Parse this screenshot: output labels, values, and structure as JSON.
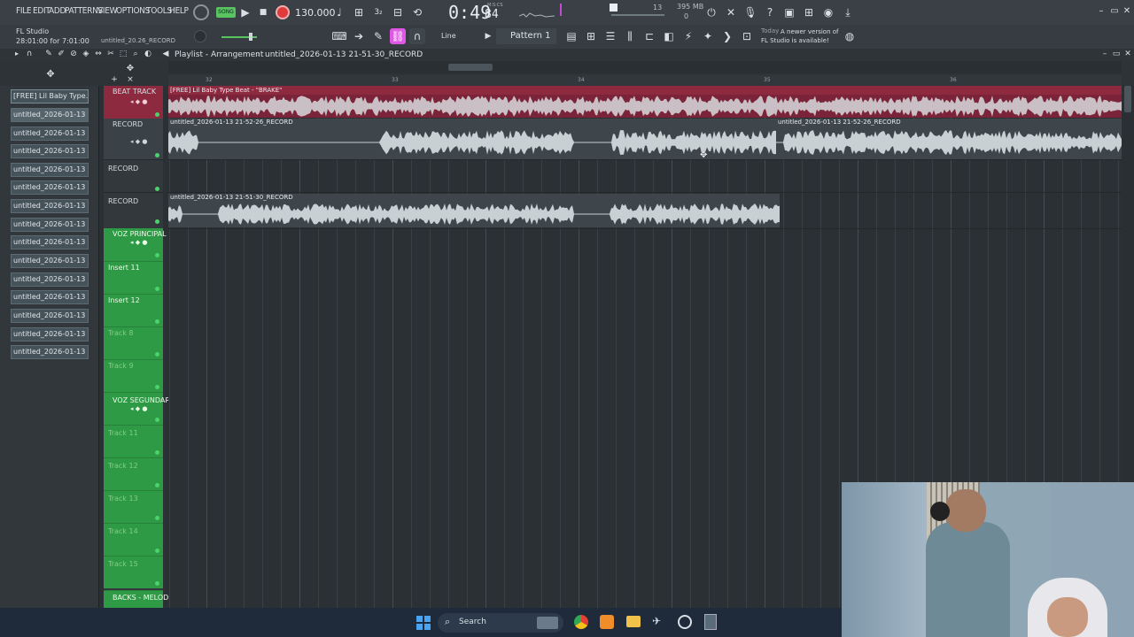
{
  "menu": [
    "FILE",
    "EDIT",
    "ADD",
    "PATTERNS",
    "VIEW",
    "OPTIONS",
    "TOOLS",
    "HELP"
  ],
  "transport": {
    "song_label": "SONG",
    "tempo": "130.000",
    "time": "0:49",
    "time_frac": "84",
    "time_unit": "M:S:CS",
    "cpu_value": "13",
    "memory": "395 MB",
    "memory_sub": "0"
  },
  "app": {
    "name": "FL Studio",
    "session_time": "28:01:00 for 7:01:00",
    "project": "untitled_20.26_RECORD"
  },
  "toolbar2": {
    "snap_label": "Line",
    "pattern_label": "Pattern 1",
    "news_today": "Today",
    "news_text": "A newer version of FL Studio is available!"
  },
  "playlist": {
    "title": "Playlist - Arrangement",
    "breadcrumb": "untitled_2026-01-13 21-51-30_RECORD",
    "bars": [
      "32",
      "33",
      "34",
      "35",
      "36"
    ]
  },
  "picker": [
    "[FREE] Lil Baby Type...",
    "untitled_2026-01-13 21-...",
    "untitled_2026-01-13 21-...",
    "untitled_2026-01-13 21-...",
    "untitled_2026-01-13 21-...",
    "untitled_2026-01-13 21-...",
    "untitled_2026-01-13 21-...",
    "untitled_2026-01-13 21-...",
    "untitled_2026-01-13 21-...",
    "untitled_2026-01-13 21-...",
    "untitled_2026-01-13 21-...",
    "untitled_2026-01-13 21-...",
    "untitled_2026-01-13 21-...",
    "untitled_2026-01-13 21-...",
    "untitled_2026-01-13 21-..."
  ],
  "tracks": [
    {
      "name": "BEAT TRACK",
      "group": true,
      "color": "#b8334f"
    },
    {
      "name": "RECORD",
      "group": true,
      "color": "#3a4045"
    },
    {
      "name": "RECORD",
      "group": false,
      "color": "#3a4045"
    },
    {
      "name": "RECORD",
      "group": false,
      "color": "#3a4045"
    },
    {
      "name": "VOZ PRINCIPAL",
      "group": true,
      "color": "#3aa34a"
    },
    {
      "name": "Insert 11",
      "group": false,
      "color": "#3aa34a"
    },
    {
      "name": "Insert 12",
      "group": false,
      "color": "#3aa34a"
    },
    {
      "name": "Track 8",
      "group": false,
      "color": "#3aa34a"
    },
    {
      "name": "Track 9",
      "group": false,
      "color": "#3aa34a"
    },
    {
      "name": "VOZ SEGUNDARIA",
      "group": true,
      "color": "#3aa34a"
    },
    {
      "name": "Track 11",
      "group": false,
      "color": "#3aa34a"
    },
    {
      "name": "Track 12",
      "group": false,
      "color": "#3aa34a"
    },
    {
      "name": "Track 13",
      "group": false,
      "color": "#3aa34a"
    },
    {
      "name": "Track 14",
      "group": false,
      "color": "#3aa34a"
    },
    {
      "name": "Track 15",
      "group": false,
      "color": "#3aa34a"
    },
    {
      "name": "BACKS - MELOD",
      "group": true,
      "color": "#3aa34a"
    }
  ],
  "clips": {
    "beat": "[FREE] Lil Baby Type Beat - \"BRAKE\"",
    "rec1a": "untitled_2026-01-13 21-52-26_RECORD",
    "rec1b": "untitled_2026-01-13 21-52-26_RECORD",
    "rec2": "untitled_2026-01-13 21-51-30_RECORD"
  },
  "taskbar": {
    "search_placeholder": "Search"
  },
  "colors": {
    "beat_track": "#b8334f",
    "clip_wave": "#c9d0d3",
    "record_btn": "#e03b3b",
    "pattern_btn": "#e057e6",
    "green_group": "#3aa34a"
  }
}
